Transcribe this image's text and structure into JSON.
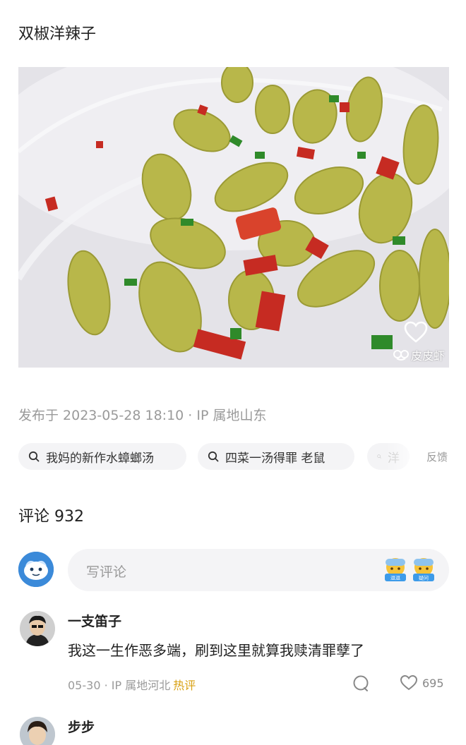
{
  "post": {
    "title": "双椒洋辣子",
    "meta": "发布于 2023-05-28 18:10 · IP 属地山东",
    "watermark": "皮皮虾"
  },
  "related_searches": [
    {
      "label": "我妈的新作水蟑螂汤"
    },
    {
      "label": "四菜一汤得罪 老鼠"
    },
    {
      "label": "洋"
    }
  ],
  "feedback_label": "反馈",
  "comments_section": {
    "header": "评论 932",
    "input_placeholder": "写评论",
    "emoji_1_label": "逗逗",
    "emoji_2_label": "疑问"
  },
  "comments": [
    {
      "name": "一支笛子",
      "text": "我这一生作恶多端，刷到这里就算我赎清罪孽了",
      "date": "05-30 · IP 属地河北",
      "badge": "热评",
      "likes": "695"
    },
    {
      "name": "步步"
    }
  ],
  "colors": {
    "accent_hot": "#d8a012",
    "meta_gray": "#9a9a9a",
    "chip_bg": "#f4f4f6"
  }
}
